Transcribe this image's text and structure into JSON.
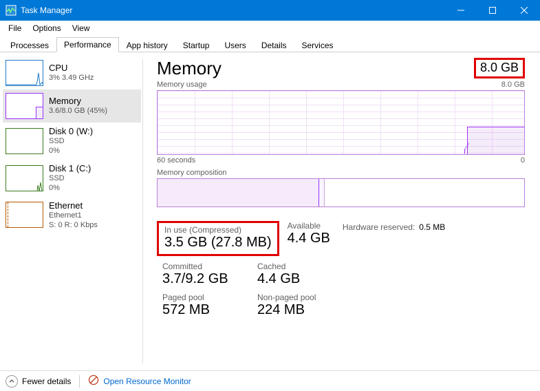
{
  "window": {
    "title": "Task Manager"
  },
  "menu": [
    "File",
    "Options",
    "View"
  ],
  "tabs": [
    "Processes",
    "Performance",
    "App history",
    "Startup",
    "Users",
    "Details",
    "Services"
  ],
  "active_tab": "Performance",
  "sidebar": {
    "items": [
      {
        "name": "CPU",
        "sub": "3% 3.49 GHz"
      },
      {
        "name": "Memory",
        "sub": "3.6/8.0 GB (45%)"
      },
      {
        "name": "Disk 0 (W:)",
        "sub": "SSD",
        "sub2": "0%"
      },
      {
        "name": "Disk 1 (C:)",
        "sub": "SSD",
        "sub2": "0%"
      },
      {
        "name": "Ethernet",
        "sub": "Ethernet1",
        "sub2": "S: 0 R: 0 Kbps"
      }
    ]
  },
  "main": {
    "title": "Memory",
    "total": "8.0 GB",
    "usage_label": "Memory usage",
    "usage_scale_right": "8.0 GB",
    "axis_left": "60 seconds",
    "axis_right": "0",
    "comp_label": "Memory composition"
  },
  "stats": {
    "in_use_label": "In use (Compressed)",
    "in_use_value": "3.5 GB (27.8 MB)",
    "avail_label": "Available",
    "avail_value": "4.4 GB",
    "hwres_label": "Hardware reserved:",
    "hwres_value": "0.5 MB",
    "committed_label": "Committed",
    "committed_value": "3.7/9.2 GB",
    "cached_label": "Cached",
    "cached_value": "4.4 GB",
    "paged_label": "Paged pool",
    "paged_value": "572 MB",
    "nonpaged_label": "Non-paged pool",
    "nonpaged_value": "224 MB"
  },
  "footer": {
    "fewer_details": "Fewer details",
    "orm": "Open Resource Monitor"
  }
}
